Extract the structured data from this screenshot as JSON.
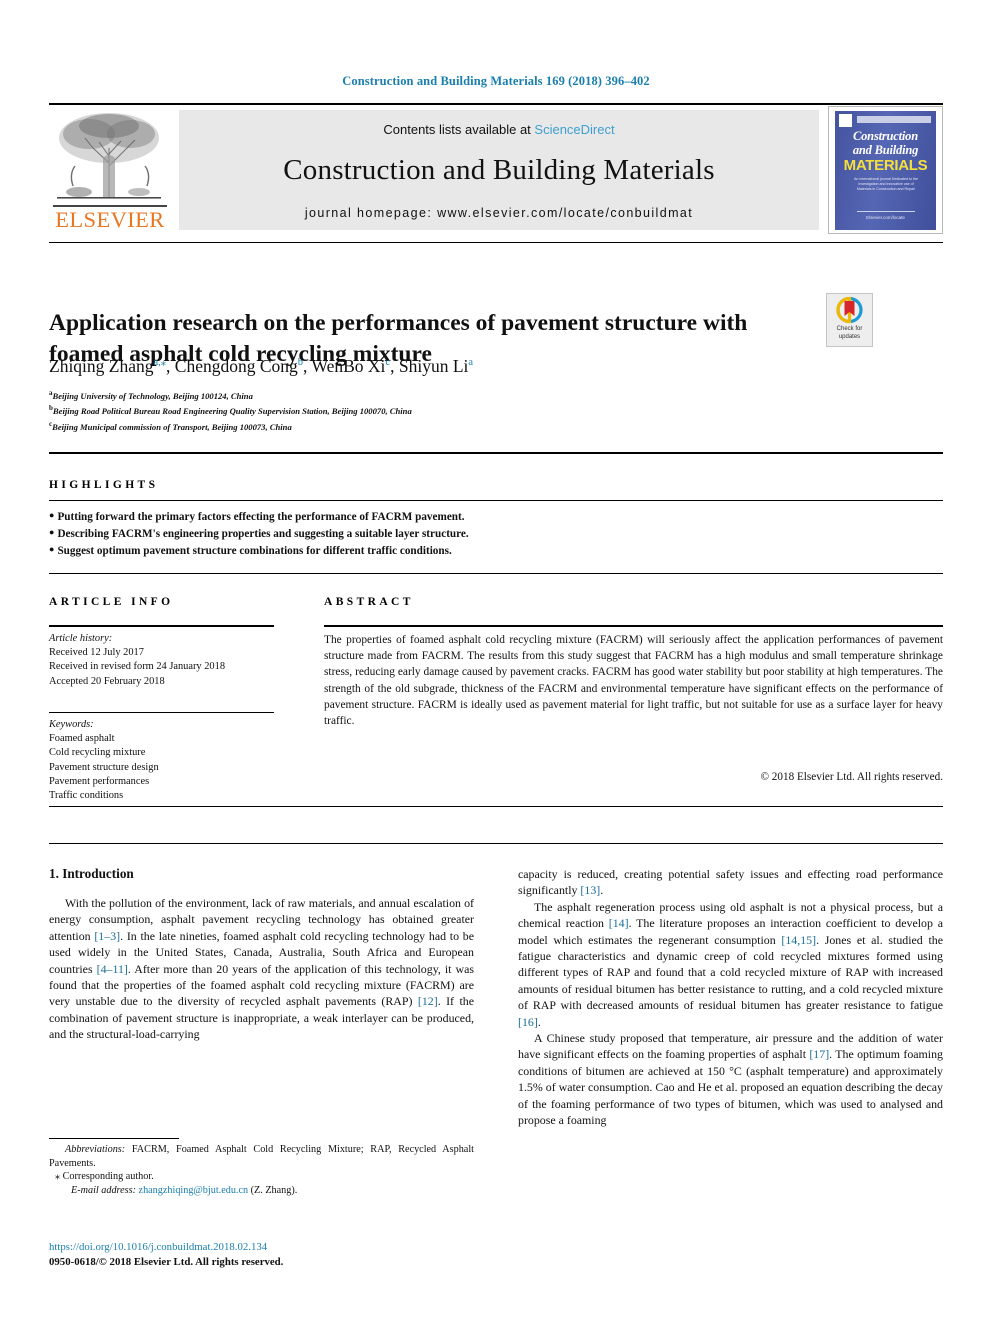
{
  "running_head": "Construction and Building Materials 169 (2018) 396–402",
  "masthead": {
    "publisher_logo_name": "elsevier-tree-logo",
    "publisher_wordmark": "ELSEVIER",
    "contents_prefix": "Contents lists available at ",
    "contents_link": "ScienceDirect",
    "journal_name": "Construction and Building Materials",
    "homepage": "journal homepage: www.elsevier.com/locate/conbuildmat",
    "cover": {
      "line1": "Construction",
      "line2": "and Building",
      "line3": "MATERIALS",
      "blurb": "An international journal Dedicated to the Investigation and Innovative use of Materials in Construction and Repair",
      "footer": "Elsevier.com/locate"
    }
  },
  "article": {
    "title": "Application research on the performances of pavement structure with foamed asphalt cold recycling mixture",
    "crossmark_line1": "Check for",
    "crossmark_line2": "updates",
    "authors": [
      {
        "name": "Zhiqing Zhang",
        "marks": "a,⁎"
      },
      {
        "name": "Chengdong Cong",
        "marks": "b"
      },
      {
        "name": "WenBo Xi",
        "marks": "c"
      },
      {
        "name": "Shiyun Li",
        "marks": "a"
      }
    ],
    "affiliations": [
      {
        "mark": "a",
        "text": "Beijing University of Technology, Beijing 100124, China"
      },
      {
        "mark": "b",
        "text": "Beijing Road Political Bureau Road Engineering Quality Supervision Station, Beijing 100070, China"
      },
      {
        "mark": "c",
        "text": "Beijing Municipal commission of Transport, Beijing 100073, China"
      }
    ]
  },
  "highlights": {
    "heading": "HIGHLIGHTS",
    "items": [
      "Putting forward the primary factors effecting the performance of FACRM pavement.",
      "Describing FACRM's engineering properties and suggesting a suitable layer structure.",
      "Suggest optimum pavement structure combinations for different traffic conditions."
    ]
  },
  "article_info": {
    "heading": "ARTICLE INFO",
    "history_label": "Article history:",
    "history": [
      "Received 12 July 2017",
      "Received in revised form 24 January 2018",
      "Accepted 20 February 2018"
    ],
    "keywords_label": "Keywords:",
    "keywords": [
      "Foamed asphalt",
      "Cold recycling mixture",
      "Pavement structure design",
      "Pavement performances",
      "Traffic conditions"
    ]
  },
  "abstract": {
    "heading": "ABSTRACT",
    "text": "The properties of foamed asphalt cold recycling mixture (FACRM) will seriously affect the application performances of pavement structure made from FACRM. The results from this study suggest that FACRM has a high modulus and small temperature shrinkage stress, reducing early damage caused by pavement cracks. FACRM has good water stability but poor stability at high temperatures. The strength of the old subgrade, thickness of the FACRM and environmental temperature have significant effects on the performance of pavement structure. FACRM is ideally used as pavement material for light traffic, but not suitable for use as a surface layer for heavy traffic.",
    "copyright": "© 2018 Elsevier Ltd. All rights reserved."
  },
  "body": {
    "section_heading": "1. Introduction",
    "left_para1_a": "With the pollution of the environment, lack of raw materials, and annual escalation of energy consumption, asphalt pavement recycling technology has obtained greater attention ",
    "left_ref1": "[1–3]",
    "left_para1_b": ". In the late nineties, foamed asphalt cold recycling technology had to be used widely in the United States, Canada, Australia, South Africa and European countries ",
    "left_ref2": "[4–11]",
    "left_para1_c": ". After more than 20 years of the application of this technology, it was found that the properties of the foamed asphalt cold recycling mixture (FACRM) are very unstable due to the diversity of recycled asphalt pavements (RAP) ",
    "left_ref3": "[12]",
    "left_para1_d": ". If the combination of pavement structure is inappropriate, a weak interlayer can be produced, and the structural-load-carrying",
    "right_para1_a": "capacity is reduced, creating potential safety issues and effecting road performance significantly ",
    "right_ref1": "[13]",
    "right_para1_b": ".",
    "right_para2_a": "The asphalt regeneration process using old asphalt is not a physical process, but a chemical reaction ",
    "right_ref2": "[14]",
    "right_para2_b": ". The literature proposes an interaction coefficient to develop a model which estimates the regenerant consumption ",
    "right_ref3": "[14,15]",
    "right_para2_c": ". Jones et al. studied the fatigue characteristics and dynamic creep of cold recycled mixtures formed using different types of RAP and found that a cold recycled mixture of RAP with increased amounts of residual bitumen has better resistance to rutting, and a cold recycled mixture of RAP with decreased amounts of residual bitumen has greater resistance to fatigue ",
    "right_ref4": "[16]",
    "right_para2_d": ".",
    "right_para3_a": "A Chinese study proposed that temperature, air pressure and the addition of water have significant effects on the foaming properties of asphalt ",
    "right_ref5": "[17]",
    "right_para3_b": ". The optimum foaming conditions of bitumen are achieved at 150 °C (asphalt temperature) and approximately 1.5% of water consumption. Cao and He et al. proposed an equation describing the decay of the foaming performance of two types of bitumen, which was used to analysed and propose a foaming"
  },
  "footnotes": {
    "abbrev_label": "Abbreviations:",
    "abbrev_text": " FACRM, Foamed Asphalt Cold Recycling Mixture; RAP, Recycled Asphalt Pavements.",
    "corresponding": "⁎ Corresponding author.",
    "email_label": "E-mail address:",
    "email": "zhangzhiqing@bjut.edu.cn",
    "email_suffix": " (Z. Zhang).",
    "doi": "https://doi.org/10.1016/j.conbuildmat.2018.02.134",
    "issn": "0950-0618/© 2018 Elsevier Ltd. All rights reserved."
  },
  "colors": {
    "header_blue": "#1a7fae",
    "link_blue": "#3f9fd0",
    "ref_blue": "#1a6e96",
    "elsevier_orange": "#E87722",
    "cover_blue": "#4456a6",
    "cover_yellow": "#f5e03a"
  }
}
